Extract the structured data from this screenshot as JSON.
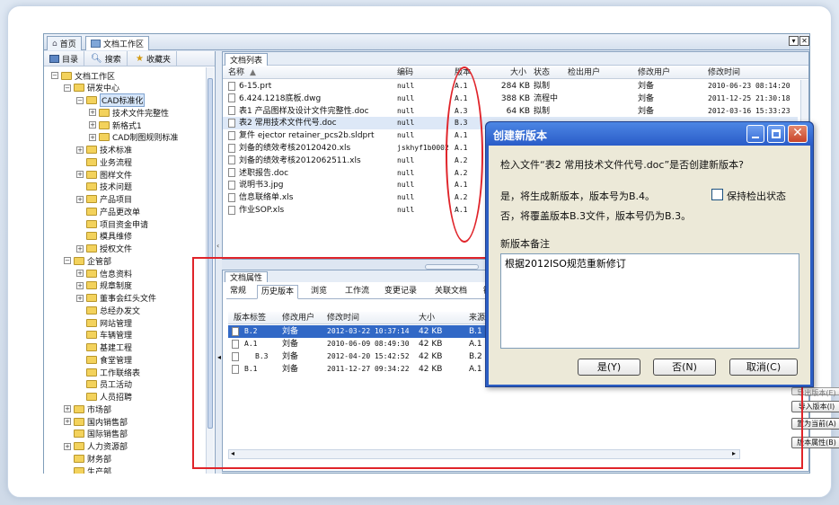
{
  "top_tabs": [
    {
      "label": "首页"
    },
    {
      "label": "文档工作区"
    }
  ],
  "left_tabs": [
    {
      "label": "目录"
    },
    {
      "label": "搜索"
    },
    {
      "label": "收藏夹"
    }
  ],
  "tree": [
    {
      "label": "文档工作区"
    },
    {
      "label": "研发中心"
    },
    {
      "label": "CAD标准化"
    },
    {
      "label": "技术文件完整性"
    },
    {
      "label": "新格式1"
    },
    {
      "label": "CAD制图规则标准"
    },
    {
      "label": "技术标准"
    },
    {
      "label": "业务流程"
    },
    {
      "label": "图样文件"
    },
    {
      "label": "技术问题"
    },
    {
      "label": "产品项目"
    },
    {
      "label": "产品更改单"
    },
    {
      "label": "项目资金申请"
    },
    {
      "label": "模具维修"
    },
    {
      "label": "授权文件"
    },
    {
      "label": "企管部"
    },
    {
      "label": "信息资料"
    },
    {
      "label": "规章制度"
    },
    {
      "label": "董事会红头文件"
    },
    {
      "label": "总经办发文"
    },
    {
      "label": "网站管理"
    },
    {
      "label": "车辆管理"
    },
    {
      "label": "基建工程"
    },
    {
      "label": "食堂管理"
    },
    {
      "label": "工作联络表"
    },
    {
      "label": "员工活动"
    },
    {
      "label": "人员招聘"
    },
    {
      "label": "市场部"
    },
    {
      "label": "国内销售部"
    },
    {
      "label": "国际销售部"
    },
    {
      "label": "人力资源部"
    },
    {
      "label": "财务部"
    },
    {
      "label": "生产部"
    }
  ],
  "doc_list": {
    "tab": "文档列表",
    "headers": {
      "name": "名称",
      "code": "编码",
      "version": "版本",
      "size": "大小",
      "status": "状态",
      "checkout": "检出用户",
      "modifier": "修改用户",
      "modified": "修改时间"
    },
    "rows": [
      {
        "name": "6-15.prt",
        "code": "null",
        "version": "A.1",
        "size": "284 KB",
        "status": "拟制",
        "modifier": "刘备",
        "modified": "2010-06-23 08:14:20"
      },
      {
        "name": "6.424.1218底板.dwg",
        "code": "null",
        "version": "A.1",
        "size": "388 KB",
        "status": "流程中",
        "modifier": "刘备",
        "modified": "2011-12-25 21:30:18"
      },
      {
        "name": "表1 产品图样及设计文件完整性.doc",
        "code": "null",
        "version": "A.3",
        "size": "64 KB",
        "status": "拟制",
        "modifier": "刘备",
        "modified": "2012-03-16 15:33:23"
      },
      {
        "name": "表2 常用技术文件代号.doc",
        "code": "null",
        "version": "B.3",
        "size": "",
        "status": "",
        "modifier": "",
        "modified": ""
      },
      {
        "name": "复件 ejector retainer_pcs2b.sldprt",
        "code": "null",
        "version": "A.1",
        "size": "",
        "status": "",
        "modifier": "",
        "modified": ""
      },
      {
        "name": "刘备的绩效考核20120420.xls",
        "code": "jskhyf1b0002",
        "version": "A.1",
        "size": "",
        "status": "",
        "modifier": "",
        "modified": ""
      },
      {
        "name": "刘备的绩效考核2012062511.xls",
        "code": "null",
        "version": "A.2",
        "size": "",
        "status": "",
        "modifier": "",
        "modified": ""
      },
      {
        "name": "述职报告.doc",
        "code": "null",
        "version": "A.2",
        "size": "",
        "status": "",
        "modifier": "",
        "modified": ""
      },
      {
        "name": "说明书3.jpg",
        "code": "null",
        "version": "A.1",
        "size": "",
        "status": "",
        "modifier": "",
        "modified": ""
      },
      {
        "name": "信息联络单.xls",
        "code": "null",
        "version": "A.2",
        "size": "",
        "status": "",
        "modifier": "",
        "modified": ""
      },
      {
        "name": "作业SOP.xls",
        "code": "null",
        "version": "A.1",
        "size": "",
        "status": "",
        "modifier": "",
        "modified": ""
      }
    ]
  },
  "attr_panel": {
    "title": "文档属性",
    "tabs": [
      {
        "label": "常规"
      },
      {
        "label": "历史版本"
      },
      {
        "label": "浏览"
      },
      {
        "label": "工作流"
      },
      {
        "label": "变更记录"
      },
      {
        "label": "关联文档"
      },
      {
        "label": "链"
      }
    ],
    "headers": {
      "label": "版本标签",
      "user": "修改用户",
      "time": "修改时间",
      "size": "大小",
      "source": "来源"
    },
    "rows": [
      {
        "label": "B.2",
        "user": "刘备",
        "time": "2012-03-22 10:37:14",
        "size": "42 KB",
        "source": "B.1"
      },
      {
        "label": "A.1",
        "user": "刘备",
        "time": "2010-06-09 08:49:30",
        "size": "42 KB",
        "source": "A.1"
      },
      {
        "label": "B.3",
        "user": "刘备",
        "time": "2012-04-20 15:42:52",
        "size": "42 KB",
        "source": "B.2"
      },
      {
        "label": "B.1",
        "user": "刘备",
        "time": "2011-12-27 09:34:22",
        "size": "42 KB",
        "source": "A.1"
      }
    ],
    "side_buttons": [
      {
        "label": "导出版本(E)"
      },
      {
        "label": "导入版本(I)"
      },
      {
        "label": "置为当前(A)"
      },
      {
        "label": "版本属性(B)"
      }
    ]
  },
  "dialog": {
    "title": "创建新版本",
    "question": "检入文件“表2 常用技术文件代号.doc”是否创建新版本?",
    "line_yes": "是，将生成新版本，版本号为B.4。",
    "line_no": "否，将覆盖版本B.3文件，版本号仍为B.3。",
    "keep_checkout": "保持检出状态",
    "keep_checkout_checked": false,
    "remark_label": "新版本备注",
    "remark_value": "根据2012ISO规范重新修订",
    "btn_yes": "是(Y)",
    "btn_no": "否(N)",
    "btn_cancel": "取消(C)"
  },
  "colors": {
    "highlight_red": "#e0242a",
    "selection_blue": "#3168c6",
    "dialog_title": "#2c5ec4"
  }
}
